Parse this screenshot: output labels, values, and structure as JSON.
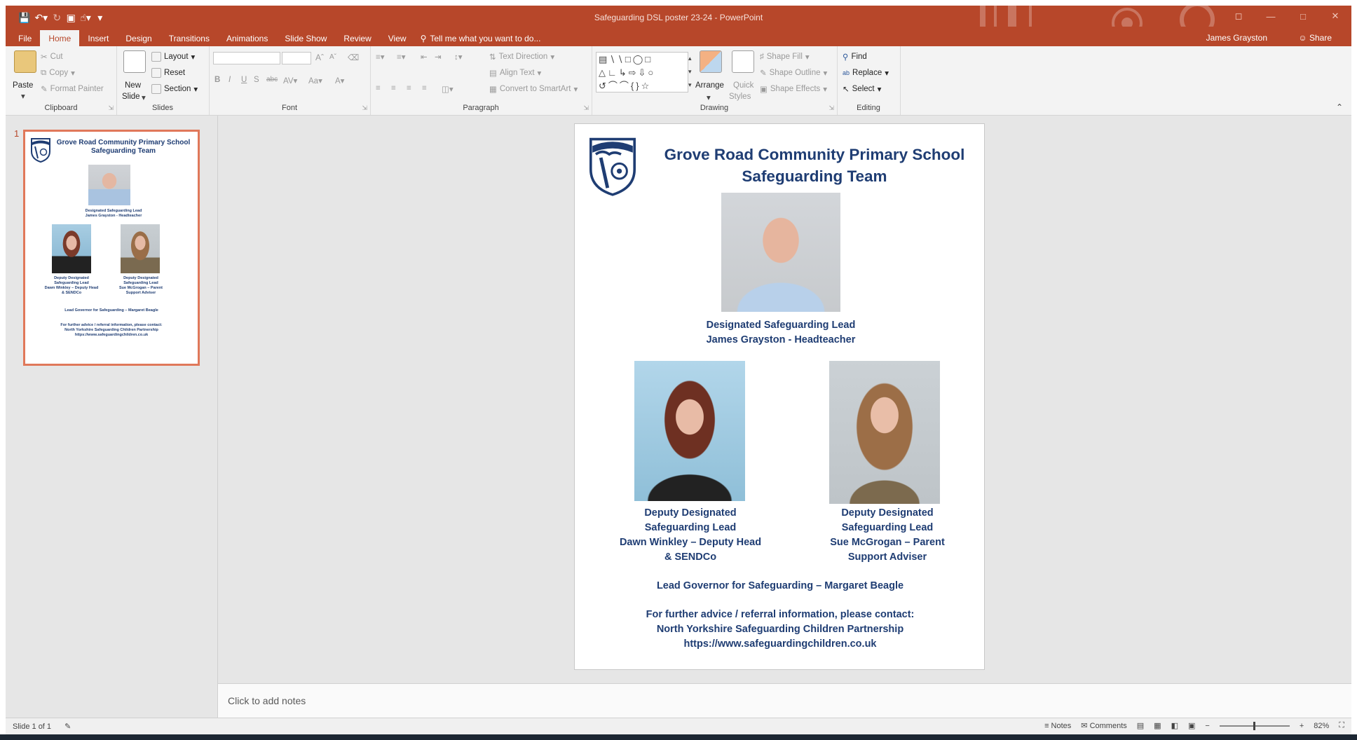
{
  "window": {
    "title": "Safeguarding DSL poster 23-24 - PowerPoint"
  },
  "tabs": [
    "File",
    "Home",
    "Insert",
    "Design",
    "Transitions",
    "Animations",
    "Slide Show",
    "Review",
    "View"
  ],
  "tell_me": "Tell me what you want to do...",
  "account": {
    "user": "James Grayston",
    "share": "Share"
  },
  "ribbon": {
    "clipboard": {
      "paste": "Paste",
      "cut": "Cut",
      "copy": "Copy",
      "format_painter": "Format Painter",
      "label": "Clipboard"
    },
    "slides": {
      "new_slide_line1": "New",
      "new_slide_line2": "Slide",
      "layout": "Layout",
      "reset": "Reset",
      "section": "Section",
      "label": "Slides"
    },
    "font": {
      "label": "Font"
    },
    "paragraph": {
      "text_direction": "Text Direction",
      "align_text": "Align Text",
      "convert_smartart": "Convert to SmartArt",
      "label": "Paragraph"
    },
    "drawing": {
      "arrange": "Arrange",
      "quick_styles_line1": "Quick",
      "quick_styles_line2": "Styles",
      "shape_fill": "Shape Fill",
      "shape_outline": "Shape Outline",
      "shape_effects": "Shape Effects",
      "label": "Drawing"
    },
    "editing": {
      "find": "Find",
      "replace": "Replace",
      "select": "Select",
      "label": "Editing"
    }
  },
  "thumbnail": {
    "number": "1"
  },
  "slide": {
    "title_line1": "Grove Road Community Primary School",
    "title_line2": "Safeguarding Team",
    "dsl_role": "Designated Safeguarding Lead",
    "dsl_name": "James Grayston - Headteacher",
    "deputy1_line1": "Deputy Designated",
    "deputy1_line2": "Safeguarding Lead",
    "deputy1_line3": "Dawn Winkley – Deputy Head",
    "deputy1_line4": "& SENDCo",
    "deputy2_line1": "Deputy Designated",
    "deputy2_line2": "Safeguarding Lead",
    "deputy2_line3": "Sue McGrogan – Parent",
    "deputy2_line4": "Support Adviser",
    "governor": "Lead Governor for Safeguarding – Margaret Beagle",
    "advice_line1": "For further advice / referral information, please contact:",
    "advice_line2": "North Yorkshire Safeguarding Children Partnership",
    "advice_line3": "https://www.safeguardingchildren.co.uk"
  },
  "notes_placeholder": "Click to add notes",
  "status": {
    "slide_count": "Slide 1 of 1",
    "notes": "Notes",
    "comments": "Comments",
    "zoom": "82%"
  },
  "colors": {
    "accent": "#b7472a",
    "navy_text": "#1f3d73"
  }
}
